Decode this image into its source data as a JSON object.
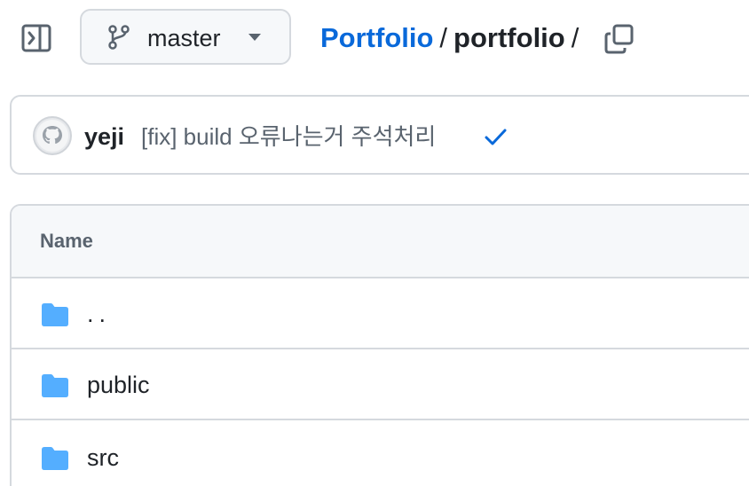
{
  "header": {
    "branch": "master",
    "breadcrumb": {
      "repo": "Portfolio",
      "separator": "/",
      "current": "portfolio",
      "trailing": "/"
    }
  },
  "commit": {
    "author": "yeji",
    "message": "[fix] build 오류나는거 주석처리",
    "status": "success"
  },
  "files": {
    "column_header": "Name",
    "rows": [
      {
        "name": "..",
        "type": "folder"
      },
      {
        "name": "public",
        "type": "folder"
      },
      {
        "name": "src",
        "type": "folder"
      }
    ]
  },
  "icons": {
    "sidebar_toggle": "sidebar-expand-icon",
    "branch": "git-branch-icon",
    "caret": "triangle-down-icon",
    "copy": "copy-icon",
    "check": "check-icon",
    "folder": "folder-icon"
  },
  "colors": {
    "link": "#0969da",
    "folder": "#54aeff",
    "check": "#0969da",
    "border": "#d5d9de",
    "muted_text": "#59636e"
  }
}
